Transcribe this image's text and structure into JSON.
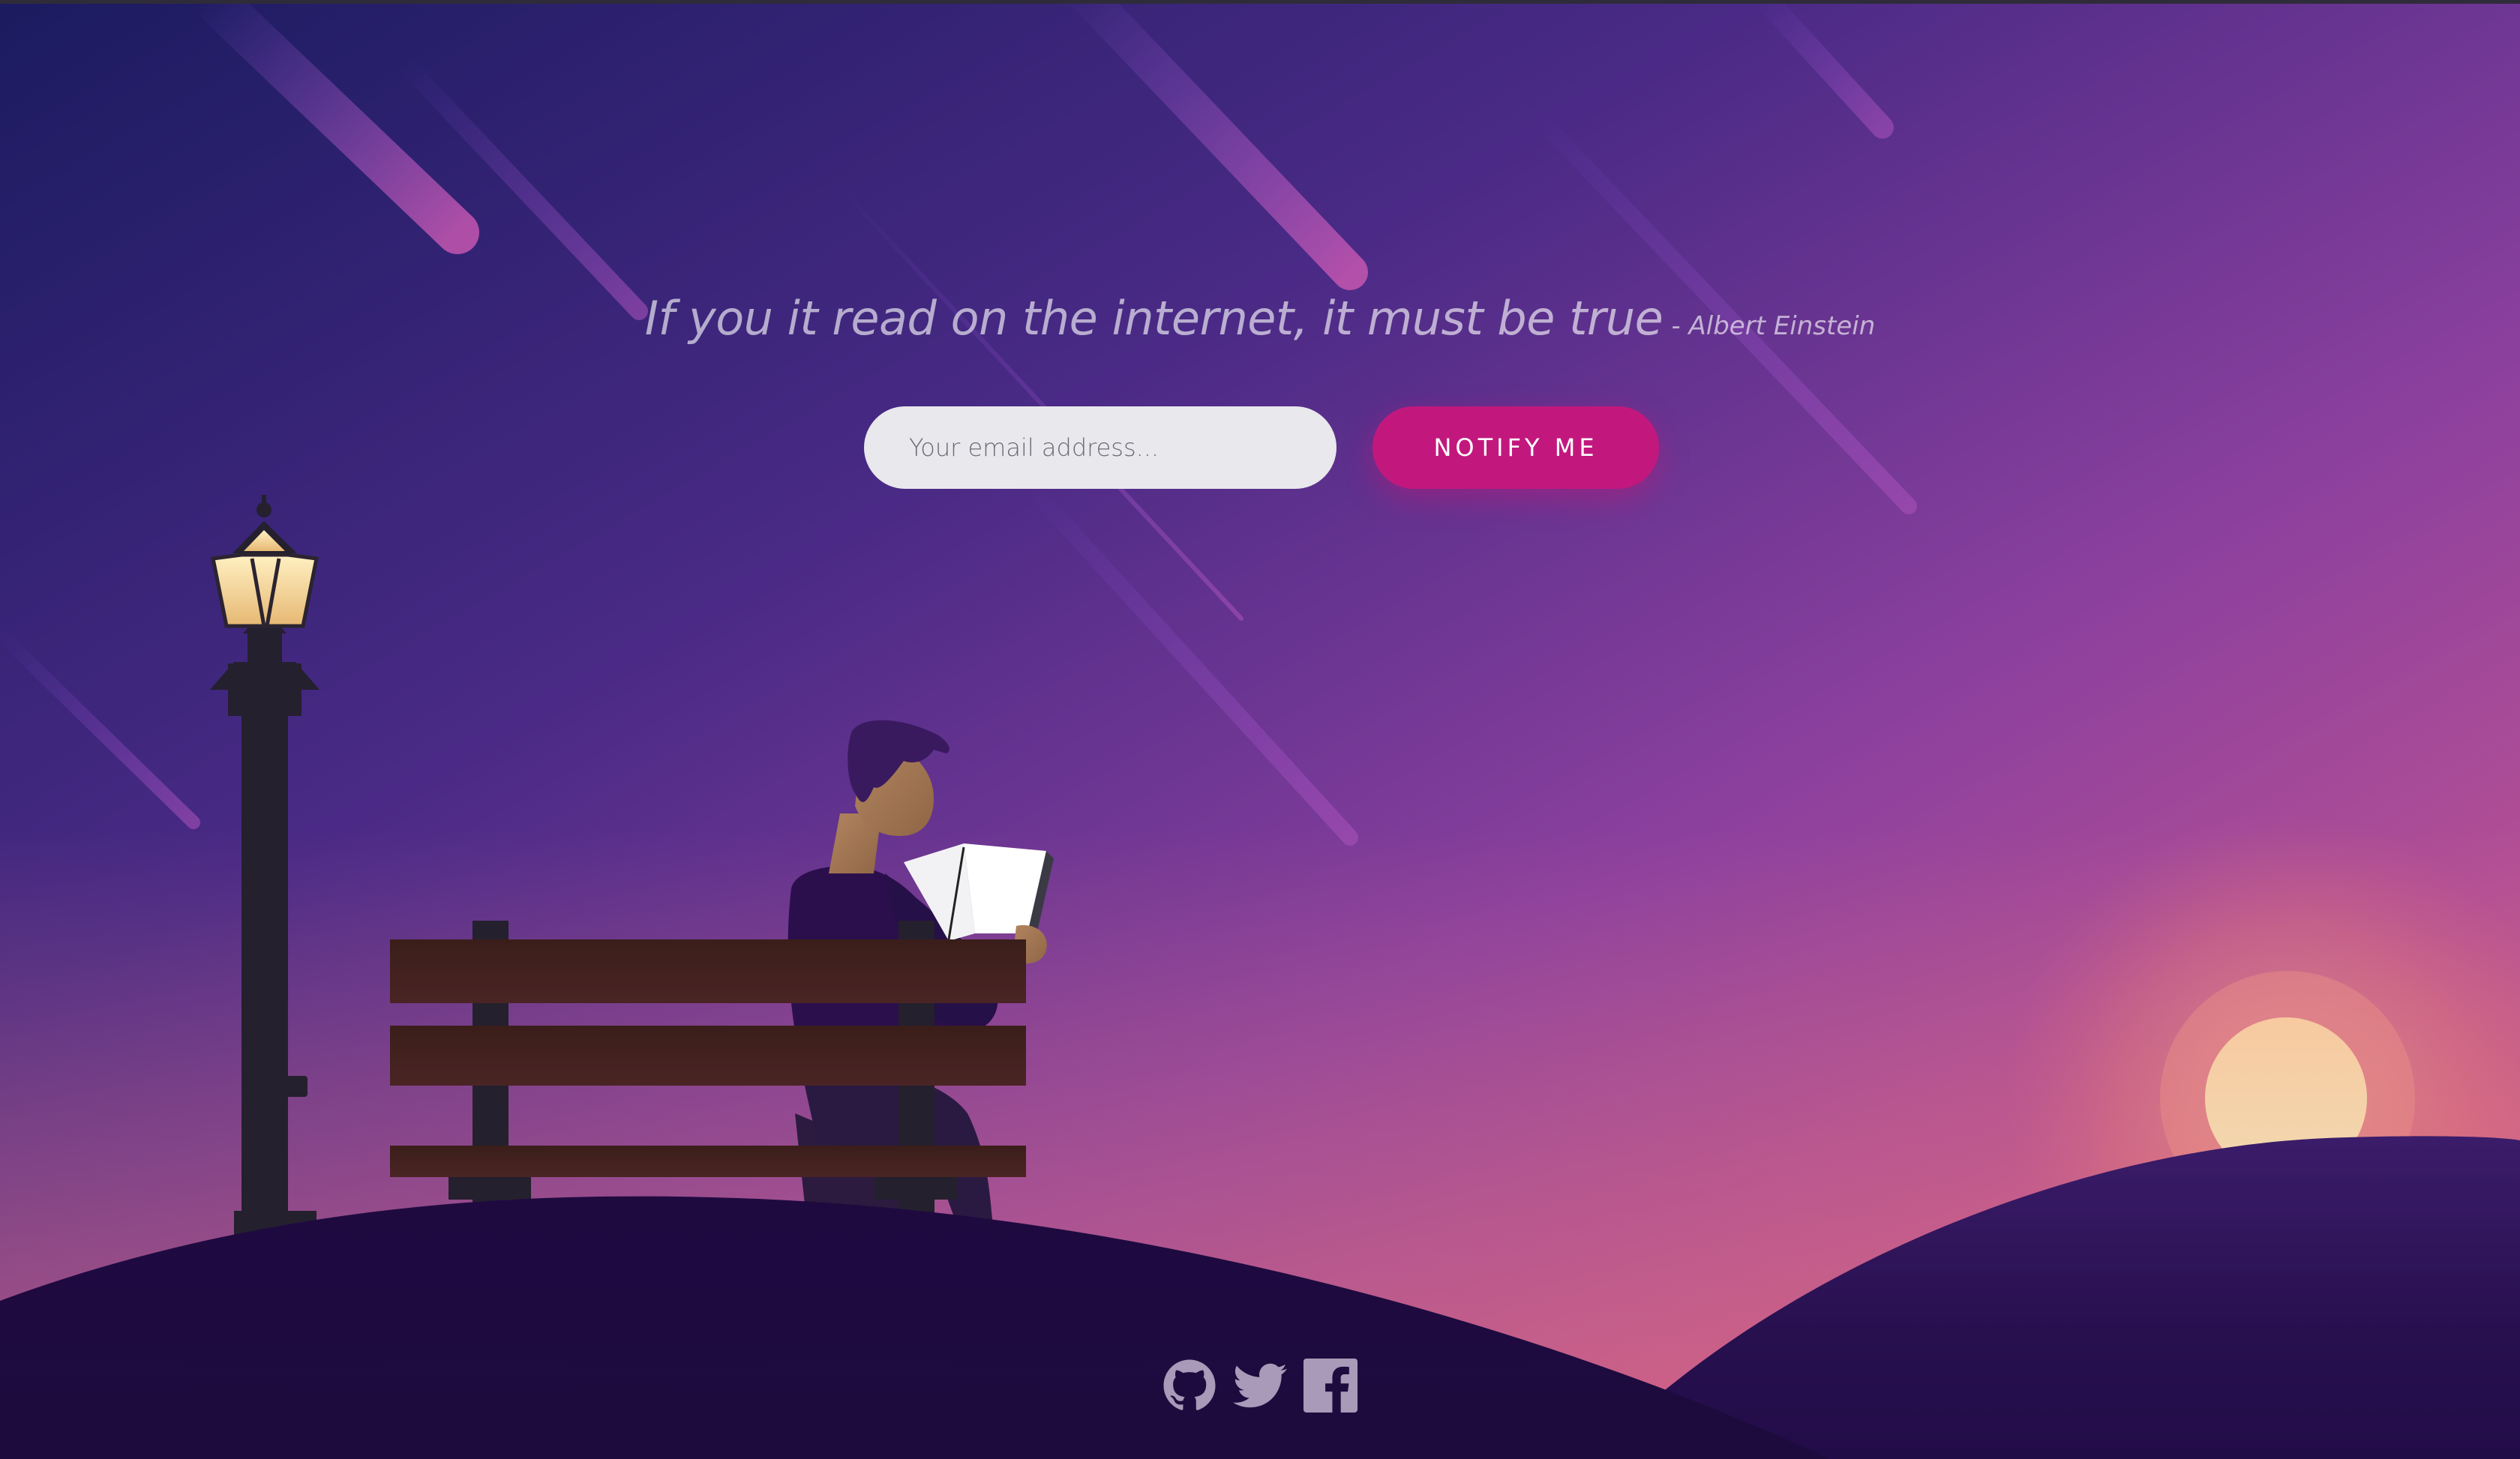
{
  "quote": {
    "text": "If you it read on the internet, it must be true",
    "author": "- Albert Einstein"
  },
  "signup": {
    "email_placeholder": "Your email address...",
    "notify_label": "NOTIFY ME"
  },
  "social": [
    {
      "icon": "github-icon"
    },
    {
      "icon": "twitter-icon"
    },
    {
      "icon": "facebook-icon"
    }
  ],
  "colors": {
    "sky_top": "#1c1a5e",
    "sky_mid": "#8a3f9c",
    "sky_horizon": "#e0707a",
    "hill": "#1e0b3e",
    "accent": "#c2187e",
    "sun": "#f5d2a0"
  }
}
